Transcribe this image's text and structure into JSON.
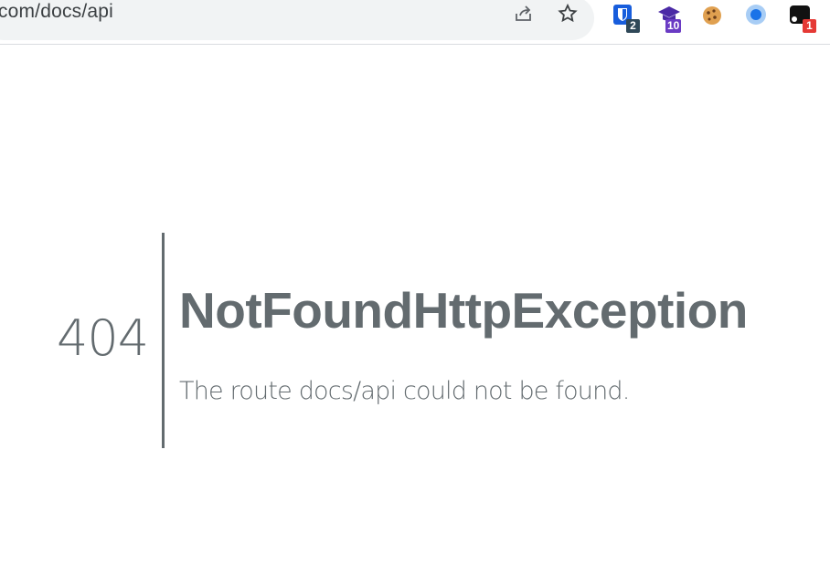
{
  "browser": {
    "url": "n.com/docs/api",
    "extensions": [
      {
        "name": "bitwarden",
        "badge": "2",
        "badge_color": "#2f4858"
      },
      {
        "name": "graduation-cap",
        "badge": "10",
        "badge_color": "#6a3bc4"
      },
      {
        "name": "cookie",
        "badge": ""
      },
      {
        "name": "blue-circle",
        "badge": ""
      },
      {
        "name": "black-extension",
        "badge": "1",
        "badge_color": "#e53935"
      }
    ]
  },
  "error": {
    "code": "404",
    "title": "NotFoundHttpException",
    "message": "The route docs/api could not be found."
  },
  "colors": {
    "text": "#636b6f",
    "omnibox_bg": "#f1f3f4"
  }
}
